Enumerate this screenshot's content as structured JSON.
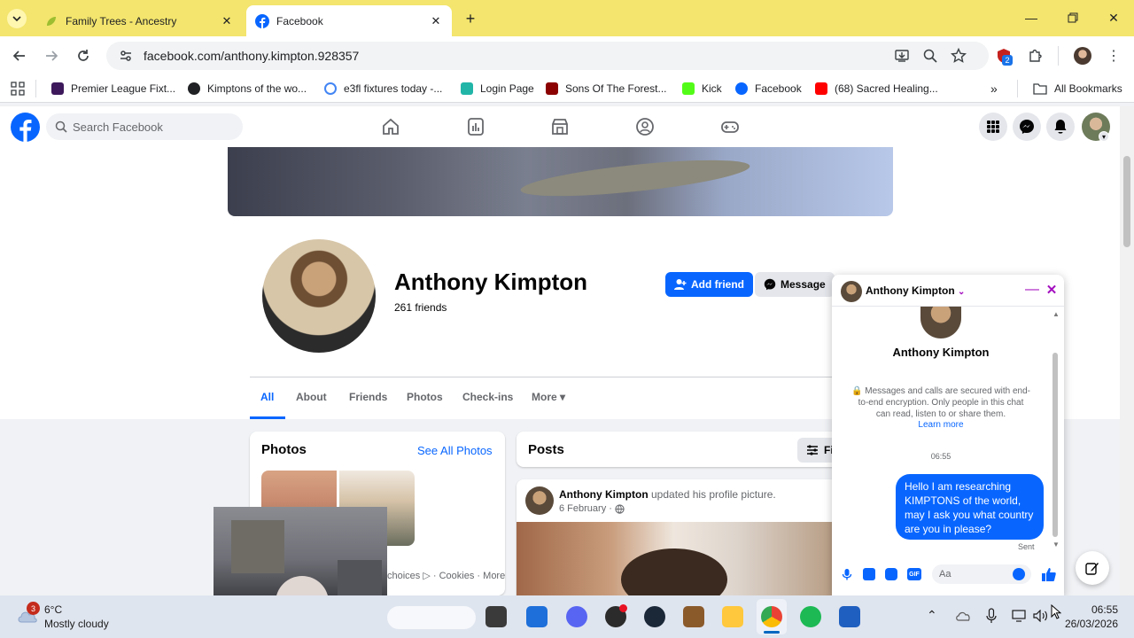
{
  "browser": {
    "tabs": [
      {
        "title": "Family Trees - Ancestry",
        "active": false
      },
      {
        "title": "Facebook",
        "active": true
      }
    ],
    "new_tab_icon": "plus-icon",
    "url": "facebook.com/anthony.kimpton.928357",
    "extensions_badge": "2",
    "bookmarks": [
      {
        "label": "Premier League Fixt...",
        "color": "#3d195b"
      },
      {
        "label": "Kimptons of the wo...",
        "color": "#202124"
      },
      {
        "label": "e3fl fixtures today -...",
        "color": "#4285f4"
      },
      {
        "label": "Login Page",
        "color": "#21b5a8"
      },
      {
        "label": "Sons Of The Forest...",
        "color": "#8b0000"
      },
      {
        "label": "Kick",
        "color": "#53fc18"
      },
      {
        "label": "Facebook",
        "color": "#0866ff"
      },
      {
        "label": "(68) Sacred Healing...",
        "color": "#ff0000"
      }
    ],
    "all_bookmarks_label": "All Bookmarks"
  },
  "fb": {
    "search_placeholder": "Search Facebook",
    "profile": {
      "name": "Anthony Kimpton",
      "friends": "261 friends",
      "add_friend": "Add friend",
      "message": "Message"
    },
    "tabs": [
      "All",
      "About",
      "Friends",
      "Photos",
      "Check-ins",
      "More"
    ],
    "photos_card": {
      "title": "Photos",
      "see_all": "See All Photos"
    },
    "footer": {
      "choices": "choices",
      "cookies": "Cookies",
      "more": "More",
      "sep": "·"
    },
    "posts_card": {
      "title": "Posts",
      "filter": "Fi",
      "post_author": "Anthony Kimpton",
      "post_action": "updated his profile picture.",
      "post_date": "6 February",
      "post_sep": "·"
    }
  },
  "chat": {
    "header_name": "Anthony Kimpton",
    "profile_name": "Anthony Kimpton",
    "encryption_text": "Messages and calls are secured with end-to-end encryption. Only people in this chat can read, listen to or share them.",
    "learn_more": "Learn more",
    "time": "06:55",
    "message": "Hello I am researching KIMPTONS of the world, may I ask you what country are you in please?",
    "status": "Sent",
    "input_placeholder": "Aa"
  },
  "taskbar": {
    "weather_temp": "6°C",
    "weather_desc": "Mostly cloudy",
    "weather_badge": "3",
    "time": "06:55",
    "date": "26/03/2026"
  },
  "colors": {
    "chrome_tab_strip": "#f3e56d",
    "fb_blue": "#0866ff",
    "chat_accent": "#a30ebf"
  }
}
